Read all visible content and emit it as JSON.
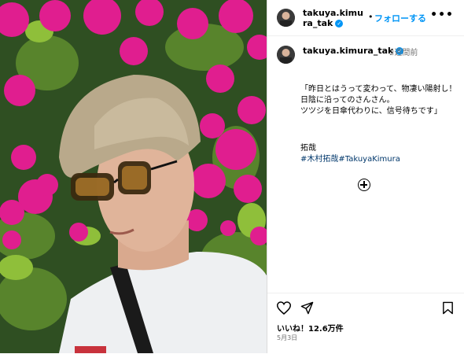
{
  "header": {
    "username": "takuya.kimura_tak",
    "separator": "•",
    "follow_label": "フォローする",
    "more_label": "•••"
  },
  "post": {
    "username": "takuya.kimura_tak",
    "time_ago": "2週間前",
    "caption": "「昨日とはうって変わって、物凄い陽射し！\n日陰に沿ってのさんさん。\nツツジを日傘代わりに、信号待ちです」",
    "author": "拓哉",
    "hashtags": "#木村拓哉#TakuyaKimura"
  },
  "footer": {
    "likes": "いいね！12.6万件",
    "date": "5月3日"
  },
  "colors": {
    "accent": "#0095f6",
    "hashtag": "#00376b",
    "azalea": "#e01e8f"
  },
  "icons": [
    "verified-badge-icon",
    "more-icon",
    "add-comment-icon",
    "heart-icon",
    "share-icon",
    "bookmark-icon"
  ]
}
